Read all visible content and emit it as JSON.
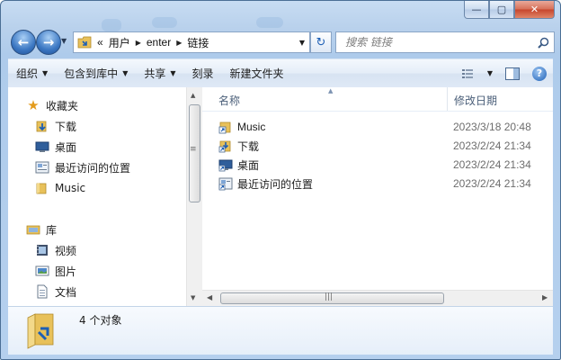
{
  "window": {
    "caption": {
      "minimize": "—",
      "maximize": "▢",
      "close": "✕"
    }
  },
  "nav": {
    "back_icon": "back-arrow-icon",
    "forward_icon": "forward-arrow-icon",
    "breadcrumbs": [
      "«",
      "用户",
      "enter",
      "链接"
    ],
    "search_placeholder": "搜索 链接"
  },
  "toolbar": {
    "organize": "组织",
    "include_in_library": "包含到库中",
    "share": "共享",
    "burn": "刻录",
    "new_folder": "新建文件夹"
  },
  "navpane": {
    "favorites": "收藏夹",
    "favorites_items": [
      "下载",
      "桌面",
      "最近访问的位置",
      "Music"
    ],
    "libraries": "库",
    "library_items": [
      "视频",
      "图片",
      "文档"
    ]
  },
  "list": {
    "columns": {
      "name": "名称",
      "modified": "修改日期"
    },
    "rows": [
      {
        "name": "Music",
        "date": "2023/3/18 20:48",
        "icon": "music-shortcut-icon"
      },
      {
        "name": "下载",
        "date": "2023/2/24 21:34",
        "icon": "downloads-shortcut-icon"
      },
      {
        "name": "桌面",
        "date": "2023/2/24 21:34",
        "icon": "desktop-shortcut-icon"
      },
      {
        "name": "最近访问的位置",
        "date": "2023/2/24 21:34",
        "icon": "recent-places-shortcut-icon"
      }
    ]
  },
  "details": {
    "count": "4 个对象"
  },
  "colors": {
    "accent": "#1d5fb5",
    "frame": "#b9d1ec",
    "folder": "#e8c15a"
  }
}
